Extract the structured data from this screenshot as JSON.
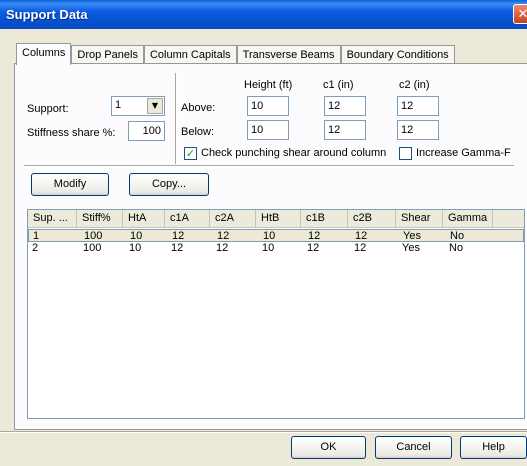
{
  "window": {
    "title": "Support Data",
    "close": "✕"
  },
  "tabs": [
    {
      "label": "Columns",
      "active": true
    },
    {
      "label": "Drop Panels",
      "active": false
    },
    {
      "label": "Column Capitals",
      "active": false
    },
    {
      "label": "Transverse Beams",
      "active": false
    },
    {
      "label": "Boundary Conditions",
      "active": false
    }
  ],
  "form": {
    "support_label": "Support:",
    "support_value": "1",
    "stiffness_label": "Stiffness share %:",
    "stiffness_value": "100",
    "height_header": "Height (ft)",
    "c1_header": "c1 (in)",
    "c2_header": "c2 (in)",
    "above_label": "Above:",
    "below_label": "Below:",
    "above": {
      "height": "10",
      "c1": "12",
      "c2": "12"
    },
    "below": {
      "height": "10",
      "c1": "12",
      "c2": "12"
    },
    "punching_label": "Check punching shear around column",
    "punching_checked": true,
    "gamma_label": "Increase Gamma-F",
    "gamma_checked": false
  },
  "actions": {
    "modify": "Modify",
    "copy": "Copy..."
  },
  "table": {
    "columns": [
      "Sup. ...",
      "Stiff%",
      "HtA",
      "c1A",
      "c2A",
      "HtB",
      "c1B",
      "c2B",
      "Shear",
      "Gamma"
    ],
    "rows": [
      [
        "1",
        "100",
        "10",
        "12",
        "12",
        "10",
        "12",
        "12",
        "Yes",
        "No"
      ],
      [
        "2",
        "100",
        "10",
        "12",
        "12",
        "10",
        "12",
        "12",
        "Yes",
        "No"
      ]
    ]
  },
  "footer": {
    "ok": "OK",
    "cancel": "Cancel",
    "help": "Help"
  },
  "colors": {
    "titlebar": "#0453d3",
    "dialog_bg": "#ece9d8",
    "check_mark": "#21a121"
  }
}
